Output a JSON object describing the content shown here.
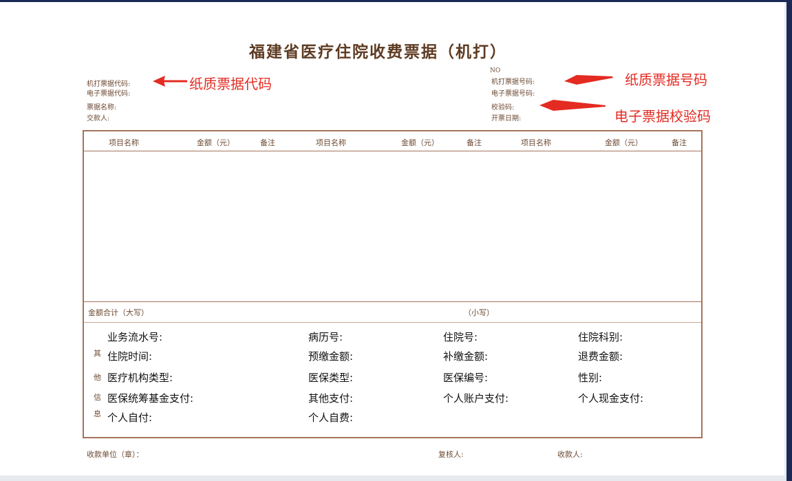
{
  "title": "福建省医疗住院收费票据（机打）",
  "header_left": [
    "机打票据代码:",
    "电子票据代码:",
    "票据名称:",
    "交款人:"
  ],
  "header_right": {
    "no": "NO",
    "fields": [
      "机打票据号码:",
      "电子票据号码:",
      "校验码:",
      "开票日期:"
    ]
  },
  "annotations": {
    "paper_code": "纸质票据代码",
    "paper_number": "纸质票据号码",
    "check_code": "电子票据校验码"
  },
  "table": {
    "columns": [
      "项目名称",
      "金额（元）",
      "备注",
      "项目名称",
      "金额（元）",
      "备注",
      "项目名称",
      "金额（元）",
      "备注"
    ]
  },
  "totals": {
    "upper_label": "金额合计（大写）",
    "lower_label": "（小写）"
  },
  "other_info_side": [
    "其",
    "他",
    "信",
    "息"
  ],
  "info_rows": [
    [
      "业务流水号:",
      "病历号:",
      "住院号:",
      "住院科别:"
    ],
    [
      "住院时间:",
      "预缴金额:",
      "补缴金额:",
      "退费金额:"
    ],
    [
      "医疗机构类型:",
      "医保类型:",
      "医保编号:",
      "性别:"
    ],
    [
      "医保统筹基金支付:",
      "其他支付:",
      "个人账户支付:",
      "个人现金支付:"
    ],
    [
      "个人自付:",
      "个人自费:",
      "",
      ""
    ]
  ],
  "footer": {
    "unit": "收款单位（章）：",
    "reviewer": "复核人:",
    "payee": "收款人:"
  },
  "colors": {
    "annotation": "#e42b22",
    "form_line": "#a4735a",
    "form_text": "#6d4a33"
  }
}
